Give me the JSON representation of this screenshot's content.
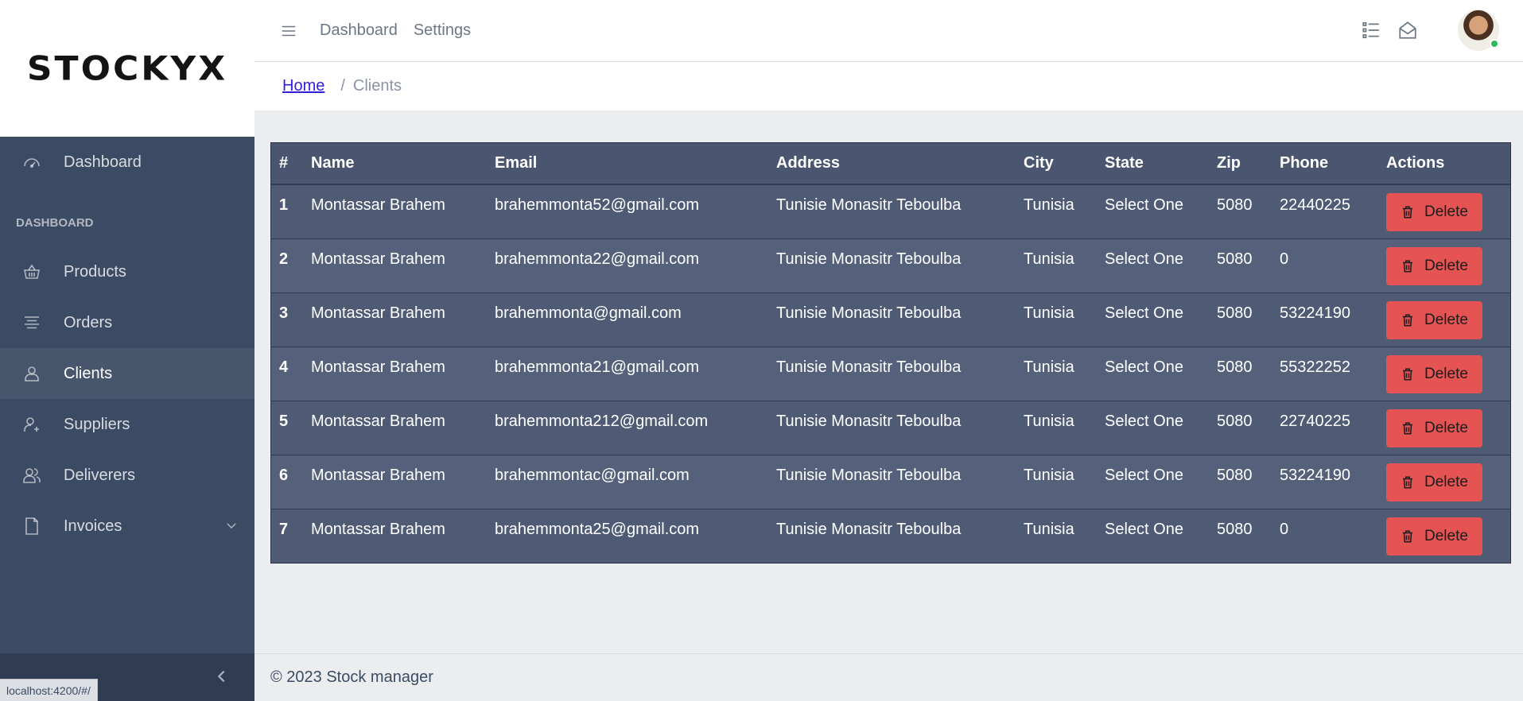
{
  "brand": {
    "name": "STOCKYX"
  },
  "header": {
    "links": [
      "Dashboard",
      "Settings"
    ],
    "icons": [
      "list-icon",
      "envelope-open-icon"
    ],
    "avatar_status_color": "#2eb85c"
  },
  "breadcrumb": {
    "home": "Home",
    "separator": "/",
    "current": "Clients"
  },
  "sidebar": {
    "dashboard": "Dashboard",
    "section_title": "DASHBOARD",
    "items": [
      {
        "label": "Products",
        "icon": "basket-icon"
      },
      {
        "label": "Orders",
        "icon": "align-center-icon"
      },
      {
        "label": "Clients",
        "icon": "user-icon",
        "active": true
      },
      {
        "label": "Suppliers",
        "icon": "user-plus-icon"
      },
      {
        "label": "Deliverers",
        "icon": "people-icon"
      },
      {
        "label": "Invoices",
        "icon": "file-icon"
      }
    ]
  },
  "status_url": "localhost:4200/#/",
  "table": {
    "headers": [
      "#",
      "Name",
      "Email",
      "Address",
      "City",
      "State",
      "Zip",
      "Phone",
      "Actions"
    ],
    "delete_label": "Delete",
    "rows": [
      {
        "id": "1",
        "name": "Montassar Brahem",
        "email": "brahemmonta52@gmail.com",
        "address": "Tunisie Monasitr Teboulba",
        "city": "Tunisia",
        "state": "Select One",
        "zip": "5080",
        "phone": "22440225"
      },
      {
        "id": "2",
        "name": "Montassar Brahem",
        "email": "brahemmonta22@gmail.com",
        "address": "Tunisie Monasitr Teboulba",
        "city": "Tunisia",
        "state": "Select One",
        "zip": "5080",
        "phone": "0"
      },
      {
        "id": "3",
        "name": "Montassar Brahem",
        "email": "brahemmonta@gmail.com",
        "address": "Tunisie Monasitr Teboulba",
        "city": "Tunisia",
        "state": "Select One",
        "zip": "5080",
        "phone": "53224190"
      },
      {
        "id": "4",
        "name": "Montassar Brahem",
        "email": "brahemmonta21@gmail.com",
        "address": "Tunisie Monasitr Teboulba",
        "city": "Tunisia",
        "state": "Select One",
        "zip": "5080",
        "phone": "55322252"
      },
      {
        "id": "5",
        "name": "Montassar Brahem",
        "email": "brahemmonta212@gmail.com",
        "address": "Tunisie Monasitr Teboulba",
        "city": "Tunisia",
        "state": "Select One",
        "zip": "5080",
        "phone": "22740225"
      },
      {
        "id": "6",
        "name": "Montassar Brahem",
        "email": "brahemmontac@gmail.com",
        "address": "Tunisie Monasitr Teboulba",
        "city": "Tunisia",
        "state": "Select One",
        "zip": "5080",
        "phone": "53224190"
      },
      {
        "id": "7",
        "name": "Montassar Brahem",
        "email": "brahemmonta25@gmail.com",
        "address": "Tunisie Monasitr Teboulba",
        "city": "Tunisia",
        "state": "Select One",
        "zip": "5080",
        "phone": "0"
      }
    ]
  },
  "footer": {
    "text": "© 2023 Stock manager"
  }
}
